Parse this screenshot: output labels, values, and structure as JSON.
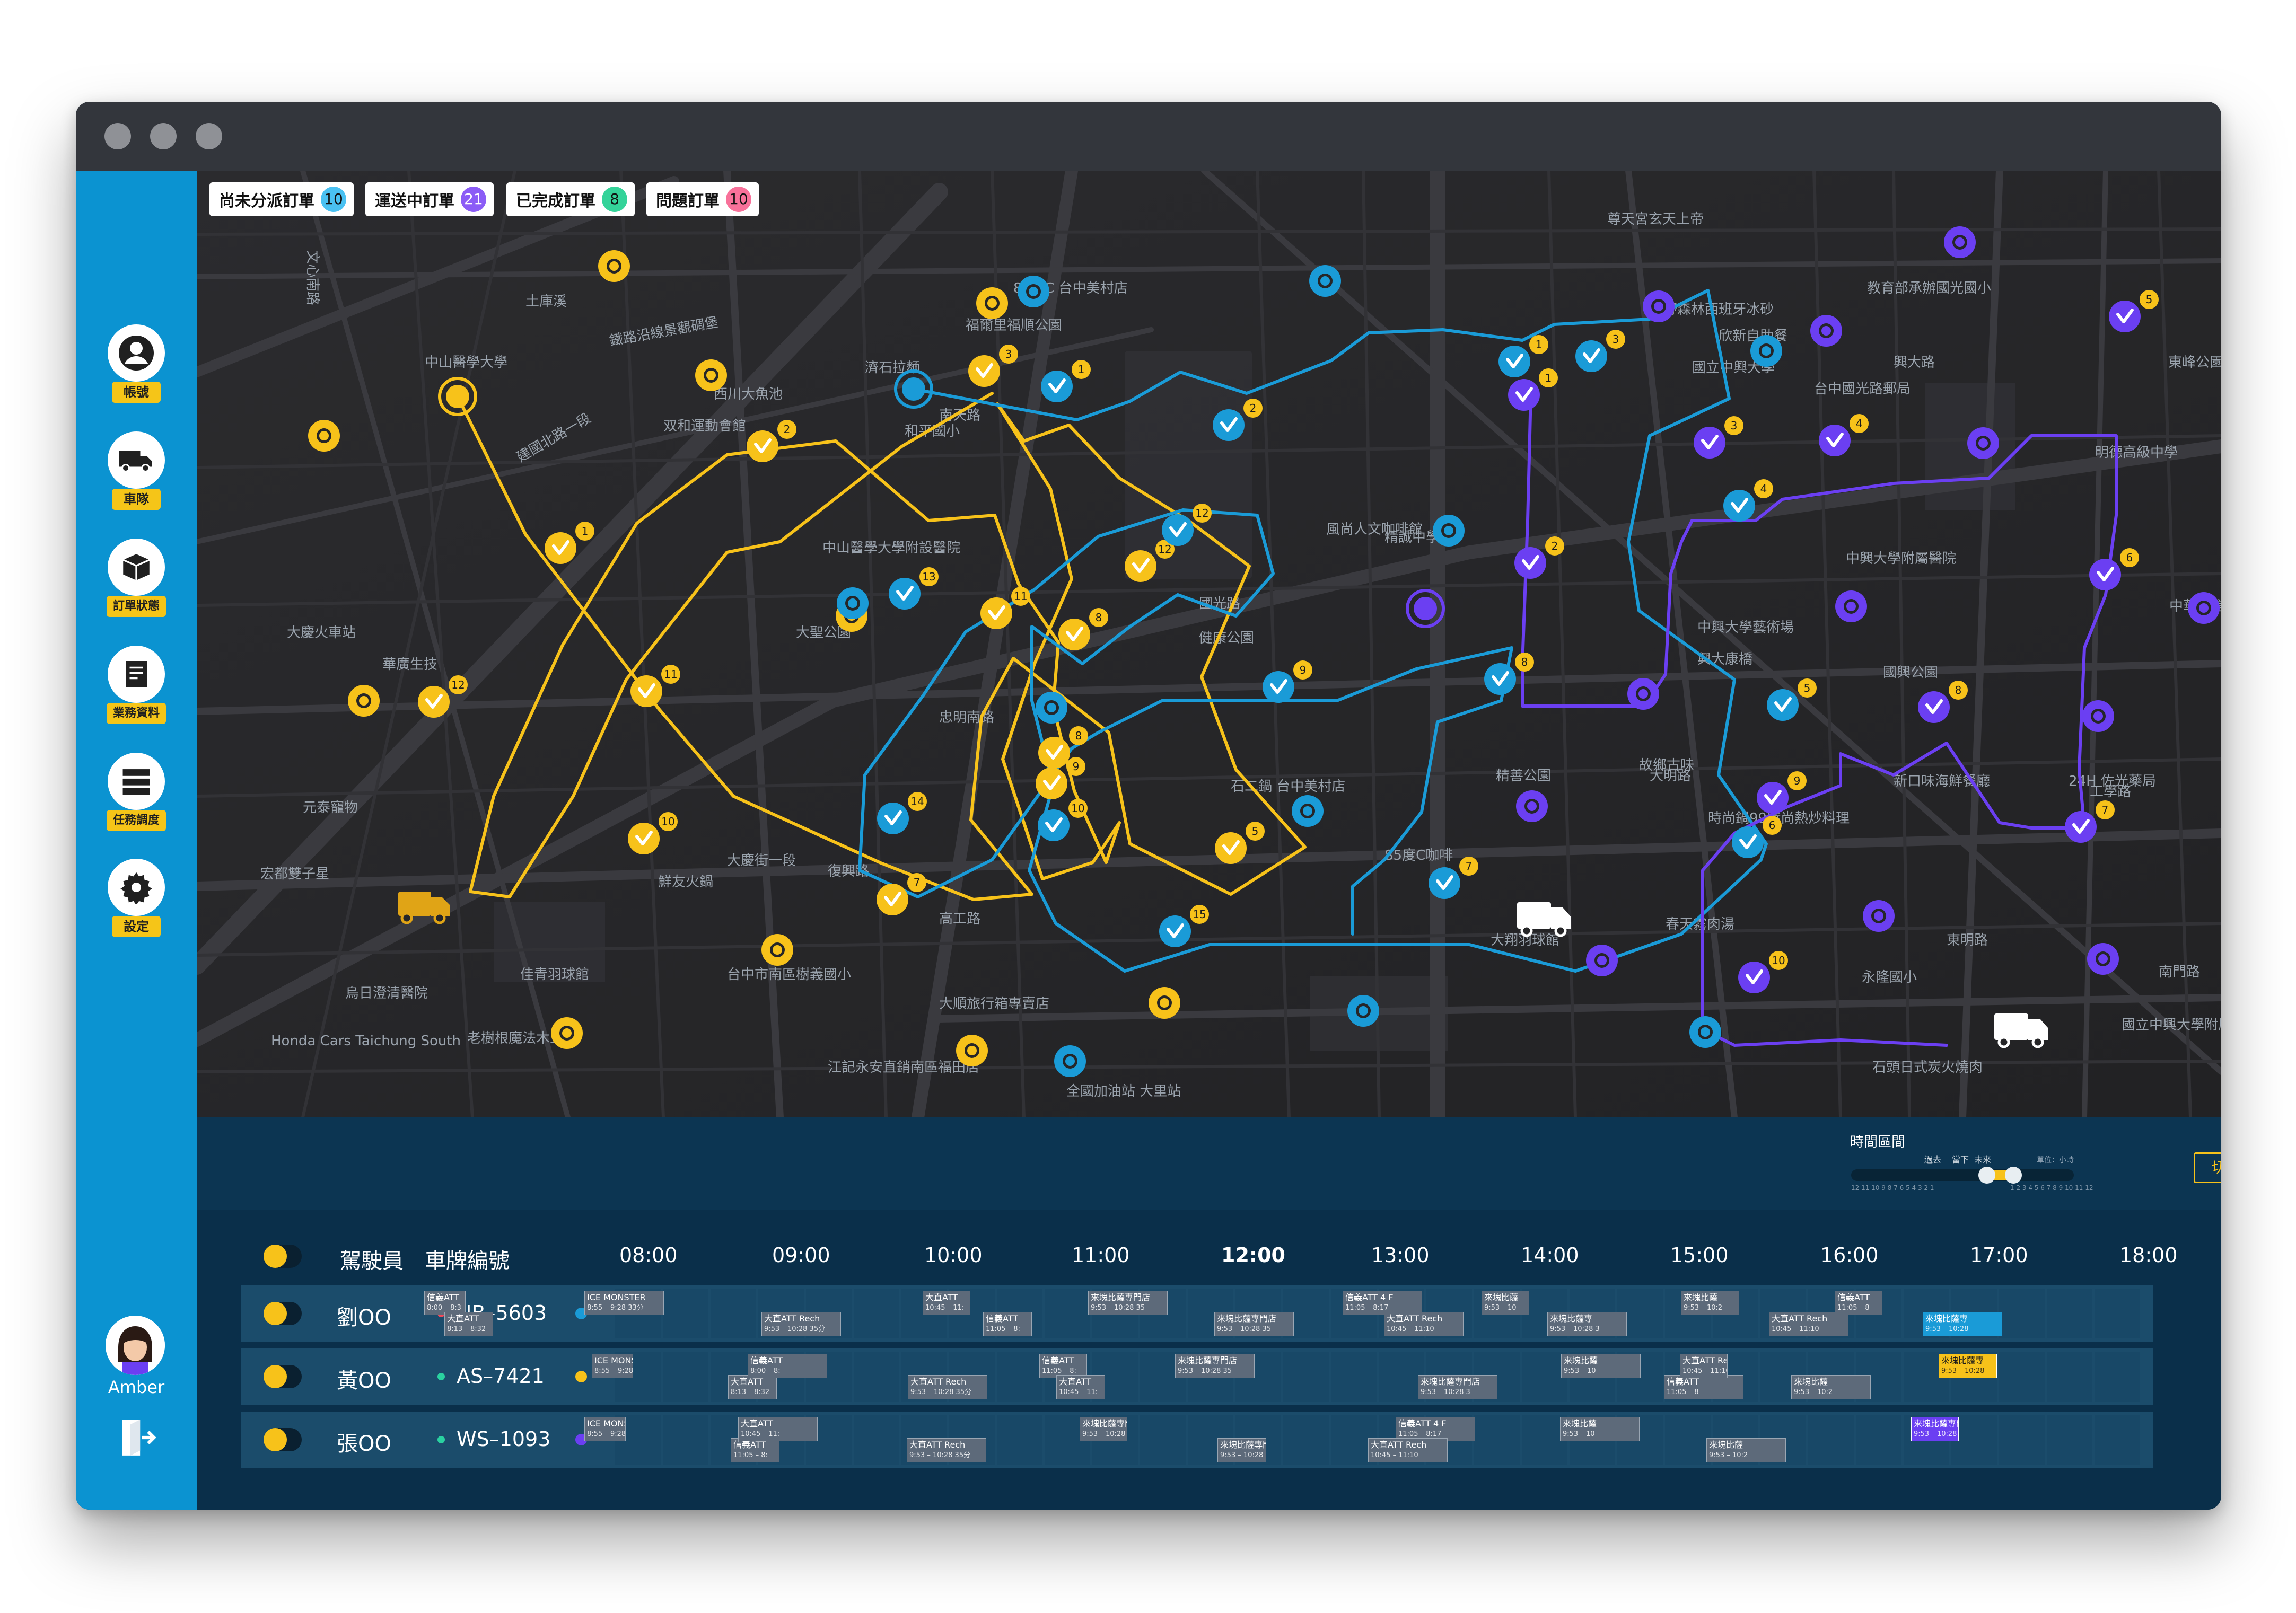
{
  "window": {
    "traffic_lights": 3
  },
  "status_badges": [
    {
      "label": "尚未分派訂單",
      "count": "10",
      "color": "#4ac1f2"
    },
    {
      "label": "運送中訂單",
      "count": "21",
      "color": "#8b5cf6"
    },
    {
      "label": "已完成訂單",
      "count": "8",
      "color": "#34d399"
    },
    {
      "label": "問題訂單",
      "count": "10",
      "color": "#f8719a"
    }
  ],
  "sidebar": {
    "items": [
      {
        "label": "帳號",
        "icon": "user-icon"
      },
      {
        "label": "車隊",
        "icon": "truck-icon"
      },
      {
        "label": "訂單狀態",
        "icon": "package-icon"
      },
      {
        "label": "業務資料",
        "icon": "document-icon"
      },
      {
        "label": "任務調度",
        "icon": "list-icon"
      },
      {
        "label": "設定",
        "icon": "gear-icon"
      }
    ],
    "user_name": "Amber"
  },
  "colors": {
    "yellow": "#f7c21a",
    "blue": "#1a9bd7",
    "purple": "#6b3ff2",
    "map_bg": "#262628",
    "panel_bg": "#0a2f4a"
  },
  "time_range": {
    "title": "時間區間",
    "past": "過去",
    "now": "當下",
    "future": "未來",
    "unit": "單位：小時",
    "past_ticks": "12 11 10 9 8 7 6 5 4 3 2 1",
    "future_ticks": "1 2 3 4 5 6 7 8 9 10 11 12",
    "switch_label": "切換"
  },
  "schedule": {
    "col_driver": "駕駛員",
    "col_plate": "車牌編號",
    "hours": [
      "08:00",
      "09:00",
      "10:00",
      "11:00",
      "12:00",
      "13:00",
      "14:00",
      "15:00",
      "16:00",
      "17:00",
      "18:00"
    ],
    "rows": [
      {
        "driver": "劉OO",
        "plate": "NB–5603",
        "status_color": "#f24a5a",
        "route_color": "#1a9bd7"
      },
      {
        "driver": "黃OO",
        "plate": "AS–7421",
        "status_color": "#2ad1a0",
        "route_color": "#f7c21a"
      },
      {
        "driver": "張OO",
        "plate": "WS–1093",
        "status_color": "#2ad1a0",
        "route_color": "#6b3ff2"
      }
    ]
  },
  "map_labels": [
    "文心南路",
    "中山醫學大學",
    "鐵路沿線景觀碉堡",
    "土庫溪",
    "建國北路一段",
    "大慶火車站",
    "華廣生技",
    "西川大魚池",
    "双和運動會館",
    "中山醫學大學附設醫院",
    "和平國小",
    "南天路",
    "濟石拉麵",
    "大聖公園",
    "福爾里福順公園",
    "85度C 台中美村店",
    "國立中興大學",
    "台中國光路郵局",
    "興大路",
    "東峰公園",
    "欣新自助餐",
    "狂野森林西班牙冰砂",
    "教育部承辦國光國小",
    "中興大學藝術場",
    "興大康橋",
    "中興大學附屬醫院",
    "國興公園",
    "24H 佐光藥局",
    "大明路",
    "精善公園",
    "石二鍋 台中美村店",
    "85度C咖啡",
    "台中市南區樹義國小",
    "大順旅行箱專賣店",
    "江記永安直銷南區福田店",
    "老樹根魔法木工坊",
    "Honda Cars Taichung South",
    "烏日澄清醫院",
    "佳青羽球館",
    "大翔羽球館",
    "全國加油站 大里站",
    "永隆國小",
    "石頭日式炭火燒肉",
    "春天霧肉湯",
    "東明路",
    "南門路",
    "明德高級中學",
    "國立中興大學附屬高級中學",
    "中華電信 大里",
    "新口味海鮮餐廳",
    "時尚鍋99時尚熱炒料理",
    "故鄉古味",
    "宏都雙子星",
    "元泰寵物",
    "高工路",
    "大慶街一段",
    "鮮友火鍋",
    "復興路",
    "精誠中學",
    "忠明南路",
    "工學路",
    "國光路",
    "健康公園",
    "風尚人文咖啡館",
    "尊天宮玄天上帝"
  ]
}
